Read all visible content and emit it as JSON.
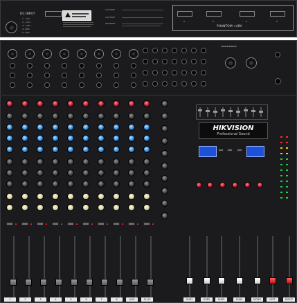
{
  "rear_top": {
    "dc_input_title": "DC INPUT",
    "dc_pins": [
      "1: -15V",
      "2: +15V",
      "3: +48V",
      "4: GND",
      "5: GND"
    ],
    "phantom_label": "PHANTOM +48V",
    "caution_labels": [
      "CAUTION",
      "CAUTION",
      "WARNING"
    ]
  },
  "brand": {
    "name": "HIKVISION",
    "subtitle": "Professional Sound"
  },
  "channels": {
    "strip_labels": [
      "1",
      "2",
      "3",
      "4",
      "5",
      "6",
      "7",
      "8",
      "9/10",
      "11/12"
    ],
    "group_labels": [
      "SUB1",
      "SUB2",
      "SUB3",
      "SUB4",
      "MONO",
      "LEFT",
      "RIGHT"
    ]
  },
  "colors": {
    "panel": "#1b1b1d",
    "knob_red": "#b0102a",
    "knob_blue": "#1e7dd8",
    "lcd_blue": "#1f50d8",
    "fader_red": "#d41d24"
  }
}
